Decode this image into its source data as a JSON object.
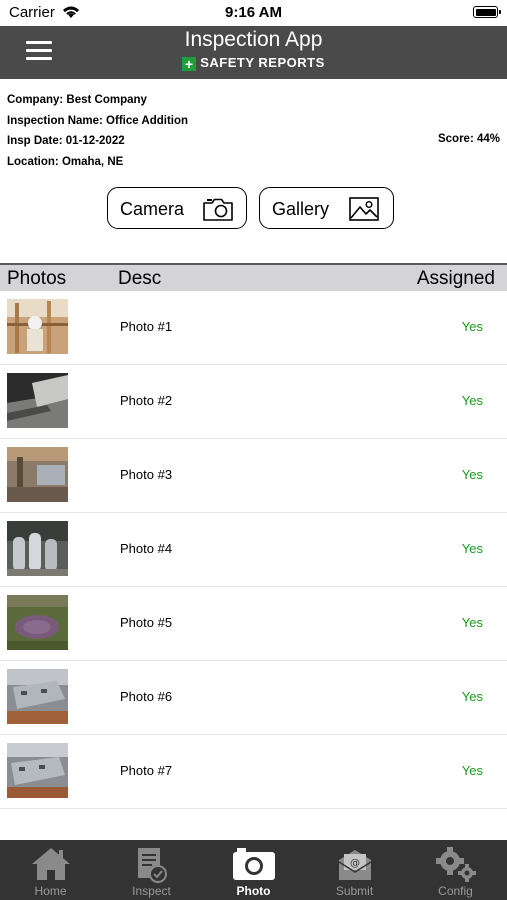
{
  "status_bar": {
    "carrier": "Carrier",
    "time": "9:16 AM"
  },
  "header": {
    "title": "Inspection App",
    "brand": "SAFETY REPORTS"
  },
  "info": {
    "company": "Company: Best Company",
    "inspection_name": "Inspection Name: Office Addition",
    "date": "Insp Date: 01-12-2022",
    "location": "Location: Omaha, NE",
    "score": "Score: 44%"
  },
  "buttons": {
    "camera_label": "Camera",
    "gallery_label": "Gallery"
  },
  "table": {
    "headers": {
      "photos": "Photos",
      "desc": "Desc",
      "assigned": "Assigned"
    },
    "rows": [
      {
        "desc": "Photo #1",
        "assigned": "Yes"
      },
      {
        "desc": "Photo #2",
        "assigned": "Yes"
      },
      {
        "desc": "Photo #3",
        "assigned": "Yes"
      },
      {
        "desc": "Photo #4",
        "assigned": "Yes"
      },
      {
        "desc": "Photo #5",
        "assigned": "Yes"
      },
      {
        "desc": "Photo #6",
        "assigned": "Yes"
      },
      {
        "desc": "Photo #7",
        "assigned": "Yes"
      }
    ]
  },
  "tabs": [
    {
      "label": "Home",
      "icon": "home-icon"
    },
    {
      "label": "Inspect",
      "icon": "inspect-icon"
    },
    {
      "label": "Photo",
      "icon": "camera-icon",
      "active": true
    },
    {
      "label": "Submit",
      "icon": "submit-icon"
    },
    {
      "label": "Config",
      "icon": "gear-icon"
    }
  ],
  "colors": {
    "header": "#4a4a4a",
    "tab_bar": "#333333",
    "assigned_yes": "#1a9a1a",
    "brand_plus": "#1f9e3a"
  }
}
